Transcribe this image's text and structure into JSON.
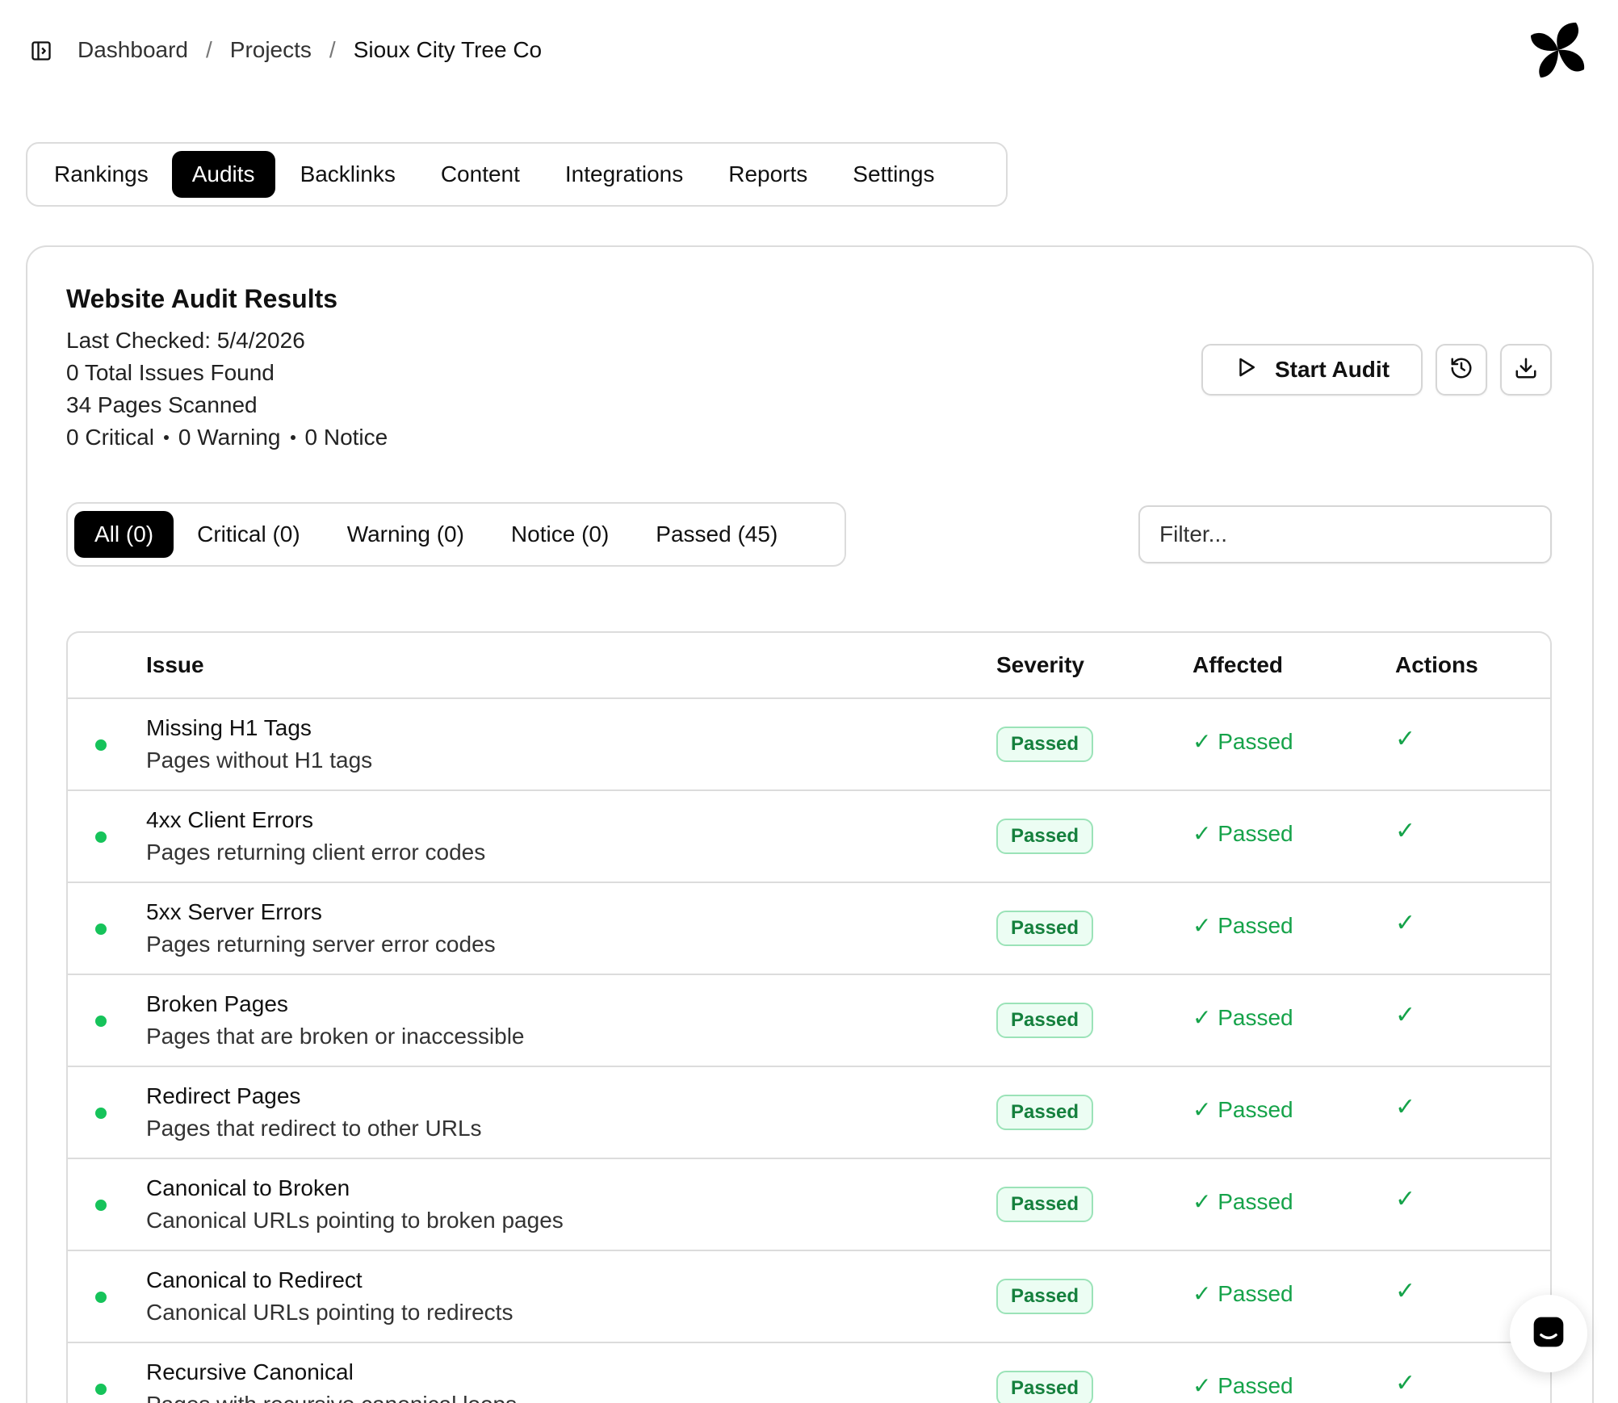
{
  "header": {
    "breadcrumb": [
      "Dashboard",
      "Projects",
      "Sioux City Tree Co"
    ],
    "separator": "/"
  },
  "nav": {
    "tabs": [
      "Rankings",
      "Audits",
      "Backlinks",
      "Content",
      "Integrations",
      "Reports",
      "Settings"
    ],
    "active": "Audits"
  },
  "audit": {
    "title": "Website Audit Results",
    "last_checked": "Last Checked: 5/4/2026",
    "total_issues": "0 Total Issues Found",
    "pages_scanned": "34 Pages Scanned",
    "critical": "0 Critical",
    "warning": "0 Warning",
    "notice": "0 Notice"
  },
  "toolbar": {
    "start_audit_label": "Start Audit"
  },
  "filters": {
    "tabs": [
      "All (0)",
      "Critical (0)",
      "Warning (0)",
      "Notice (0)",
      "Passed (45)"
    ],
    "active": "All (0)",
    "placeholder": "Filter..."
  },
  "table": {
    "headers": {
      "issue": "Issue",
      "severity": "Severity",
      "affected": "Affected",
      "actions": "Actions"
    },
    "rows": [
      {
        "title": "Missing H1 Tags",
        "desc": "Pages without H1 tags",
        "severity": "Passed",
        "affected": "✓ Passed",
        "action": "✓"
      },
      {
        "title": "4xx Client Errors",
        "desc": "Pages returning client error codes",
        "severity": "Passed",
        "affected": "✓ Passed",
        "action": "✓"
      },
      {
        "title": "5xx Server Errors",
        "desc": "Pages returning server error codes",
        "severity": "Passed",
        "affected": "✓ Passed",
        "action": "✓"
      },
      {
        "title": "Broken Pages",
        "desc": "Pages that are broken or inaccessible",
        "severity": "Passed",
        "affected": "✓ Passed",
        "action": "✓"
      },
      {
        "title": "Redirect Pages",
        "desc": "Pages that redirect to other URLs",
        "severity": "Passed",
        "affected": "✓ Passed",
        "action": "✓"
      },
      {
        "title": "Canonical to Broken",
        "desc": "Canonical URLs pointing to broken pages",
        "severity": "Passed",
        "affected": "✓ Passed",
        "action": "✓"
      },
      {
        "title": "Canonical to Redirect",
        "desc": "Canonical URLs pointing to redirects",
        "severity": "Passed",
        "affected": "✓ Passed",
        "action": "✓"
      },
      {
        "title": "Recursive Canonical",
        "desc": "Pages with recursive canonical loops",
        "severity": "Passed",
        "affected": "✓ Passed",
        "action": "✓"
      }
    ]
  },
  "colors": {
    "accent": "#000000",
    "passed_green": "#16a34a",
    "dot_green": "#16c35a",
    "border": "#dcdcdc"
  },
  "icons": {
    "sidebar_toggle": "sidebar-toggle-icon",
    "logo": "pinwheel-logo",
    "start": "play-icon",
    "history": "history-icon",
    "download": "download-icon",
    "chat": "chat-icon"
  }
}
